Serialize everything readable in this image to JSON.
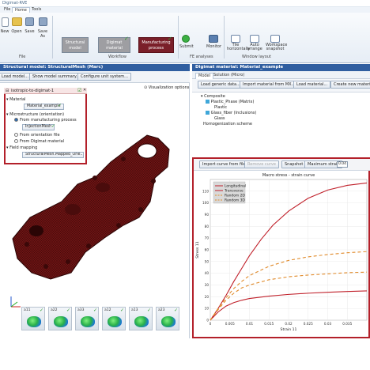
{
  "app": {
    "title": "Digimat-RVE",
    "tabs": [
      "File",
      "Home",
      "Tools"
    ]
  },
  "ribbon": {
    "file_buttons": [
      "New",
      "Open",
      "Save",
      "Save As"
    ],
    "workflow_buttons": [
      "Structural model",
      "Digimat material",
      "Manufacturing process"
    ],
    "fe_buttons": [
      "Submit",
      "Monitor"
    ],
    "layout_buttons": [
      "Tile horizontally",
      "Auto arrange",
      "Workspace snapshot"
    ],
    "group_labels": [
      "File",
      "Workflow",
      "FE analyses",
      "Window layout"
    ]
  },
  "left_panel": {
    "title": "Structural model: StructuralMesh (Marc)",
    "toolbar": [
      "Load model...",
      "Show model summary...",
      "Configure unit system..."
    ],
    "visualization_label": "Visualization options",
    "mapping": {
      "title": "isotropic-to-digimat-1",
      "material_label": "Material",
      "material_value": "Material_example",
      "micro_label": "Microstructure (orientation)",
      "from_process": "From manufacturing process",
      "process_value": "InjectionMesh",
      "from_file": "From orientation file",
      "from_digimat": "From Digimat material",
      "field_label": "Field mapping",
      "field_value": "StructuralMesh.Mapped_Orie..."
    },
    "thumbnails": [
      "a11",
      "a22",
      "a33",
      "a12",
      "a13",
      "a23"
    ]
  },
  "right_panel": {
    "title": "Digimat material: Material_example",
    "tabs": [
      "Model",
      "Solution (Micro)"
    ],
    "toolbar": [
      "Load generic data...",
      "Import material from MX...",
      "Load material...",
      "Create new material..."
    ],
    "tree": {
      "root": "Composite",
      "matrix": "Plastic_Phase (Matrix)",
      "matrix_sub": "Plastic",
      "fiber": "Glass_fiber (Inclusions)",
      "fiber_sub": "Glass",
      "homog": "Homogenization scheme"
    },
    "plot_toolbar": {
      "import_btn": "Import curve from file...",
      "remove_btn": "Remove curve",
      "snapshot_btn": "Snapshot",
      "strain_label": "Maximum strain",
      "strain_value": "0.04"
    }
  },
  "chart_data": {
    "type": "line",
    "title": "Macro stress - strain curve",
    "xlabel": "Strain 11",
    "ylabel": "Stress 11",
    "xlim": [
      0,
      0.04
    ],
    "ylim": [
      0,
      120
    ],
    "xticks": [
      "0",
      "0.005",
      "0.01",
      "0.015",
      "0.02",
      "0.025",
      "0.03",
      "0.035"
    ],
    "yticks": [
      "0",
      "10",
      "20",
      "30",
      "40",
      "50",
      "60",
      "70",
      "80",
      "90",
      "100",
      "110"
    ],
    "legend": "top-left",
    "series": [
      {
        "name": "Longitudinal",
        "color": "#c0202a",
        "dash": "",
        "x": [
          0,
          0.002,
          0.004,
          0.006,
          0.008,
          0.01,
          0.013,
          0.016,
          0.02,
          0.025,
          0.03,
          0.035,
          0.04
        ],
        "y": [
          0,
          10,
          21,
          33,
          44,
          55,
          69,
          81,
          93,
          104,
          111,
          115,
          117
        ]
      },
      {
        "name": "Transverse",
        "color": "#c0202a",
        "dash": "",
        "x": [
          0,
          0.002,
          0.004,
          0.006,
          0.008,
          0.01,
          0.015,
          0.02,
          0.025,
          0.03,
          0.035,
          0.04
        ],
        "y": [
          0,
          7,
          12,
          15,
          17,
          18.5,
          20.5,
          22,
          23,
          23.8,
          24.5,
          25
        ]
      },
      {
        "name": "Random 2D",
        "color": "#e08a2a",
        "dash": "4,3",
        "x": [
          0,
          0.002,
          0.004,
          0.006,
          0.008,
          0.01,
          0.015,
          0.02,
          0.025,
          0.03,
          0.035,
          0.04
        ],
        "y": [
          0,
          10,
          19,
          27,
          33,
          38,
          46,
          51,
          54,
          56,
          57.5,
          58.5
        ]
      },
      {
        "name": "Random 3D",
        "color": "#e08a2a",
        "dash": "4,3",
        "x": [
          0,
          0.002,
          0.004,
          0.006,
          0.008,
          0.01,
          0.015,
          0.02,
          0.025,
          0.03,
          0.035,
          0.04
        ],
        "y": [
          0,
          9,
          17,
          23,
          27.5,
          30,
          34.5,
          37,
          38.5,
          39.5,
          40.5,
          41
        ]
      }
    ]
  }
}
